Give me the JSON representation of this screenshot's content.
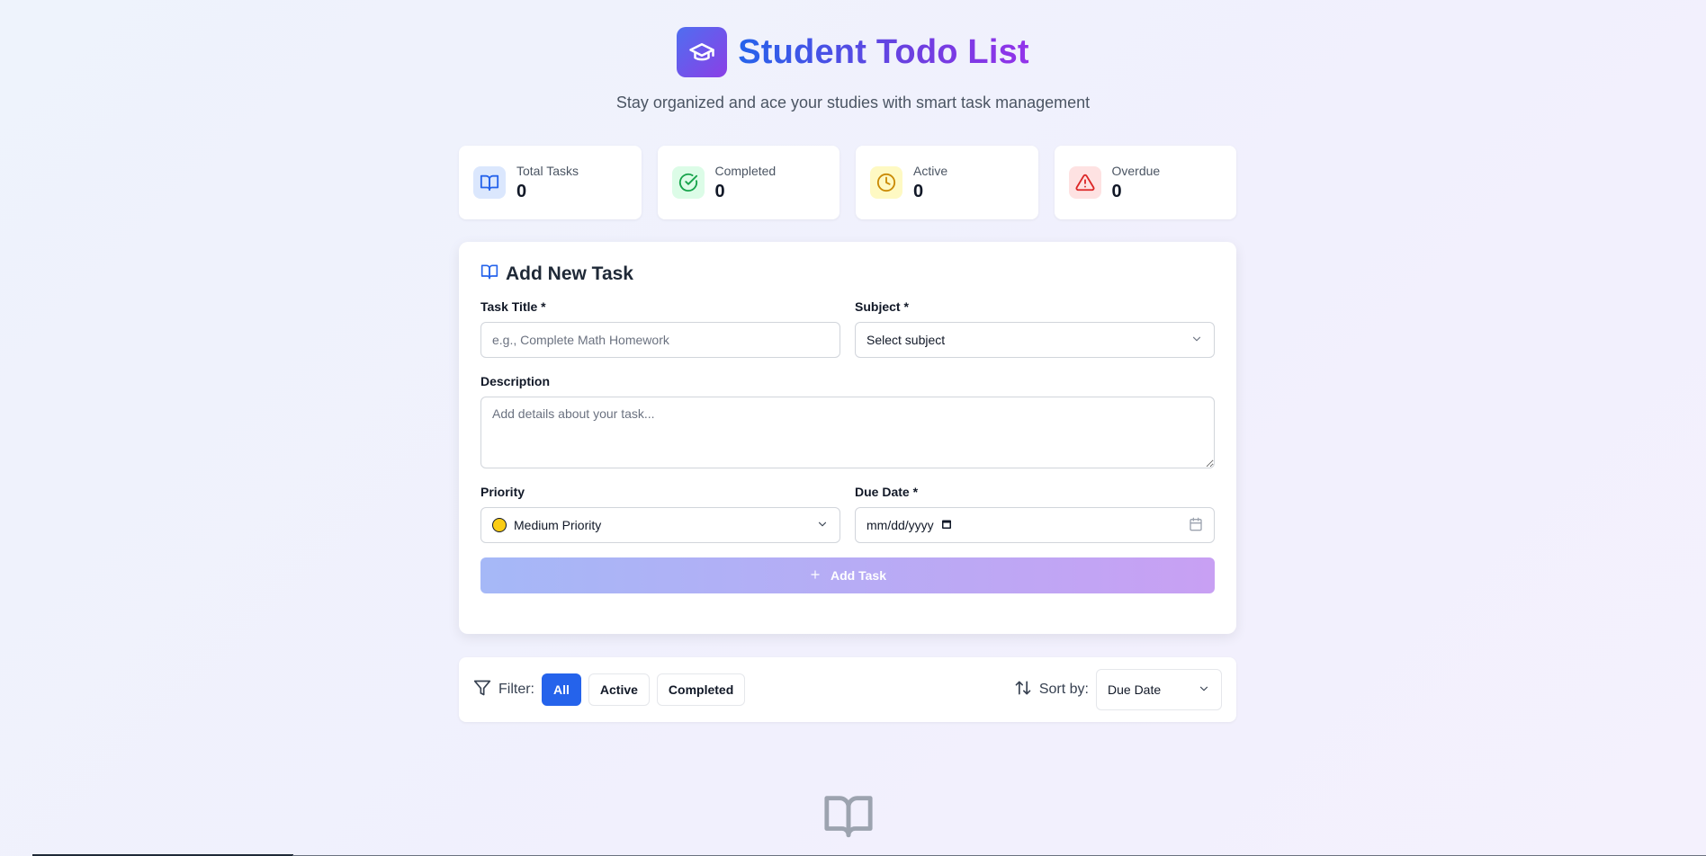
{
  "header": {
    "title": "Student Todo List",
    "subtitle": "Stay organized and ace your studies with smart task management",
    "logo_icon": "graduation-cap-icon"
  },
  "stats": [
    {
      "label": "Total Tasks",
      "value": "0",
      "icon": "book-open-icon",
      "color": "#2563eb",
      "bg": "#dbe7fd"
    },
    {
      "label": "Completed",
      "value": "0",
      "icon": "check-circle-icon",
      "color": "#16a34a",
      "bg": "#dcfce7"
    },
    {
      "label": "Active",
      "value": "0",
      "icon": "clock-icon",
      "color": "#ca8a04",
      "bg": "#fef9c3"
    },
    {
      "label": "Overdue",
      "value": "0",
      "icon": "alert-triangle-icon",
      "color": "#dc2626",
      "bg": "#fee2e2"
    }
  ],
  "form": {
    "title": "Add New Task",
    "task_title_label": "Task Title *",
    "task_title_placeholder": "e.g., Complete Math Homework",
    "subject_label": "Subject *",
    "subject_value": "Select subject",
    "description_label": "Description",
    "description_placeholder": "Add details about your task...",
    "priority_label": "Priority",
    "priority_value": "Medium Priority",
    "due_date_label": "Due Date *",
    "due_date_value": "mm/dd/yyyy",
    "add_button_label": "Add Task"
  },
  "filter": {
    "label": "Filter:",
    "options": [
      "All",
      "Active",
      "Completed"
    ],
    "selected": "All",
    "sort_label": "Sort by:",
    "sort_value": "Due Date"
  },
  "colors": {
    "accent": "#2563eb",
    "brand_gradient_start": "#4f6ef0",
    "brand_gradient_end": "#9333ea"
  }
}
